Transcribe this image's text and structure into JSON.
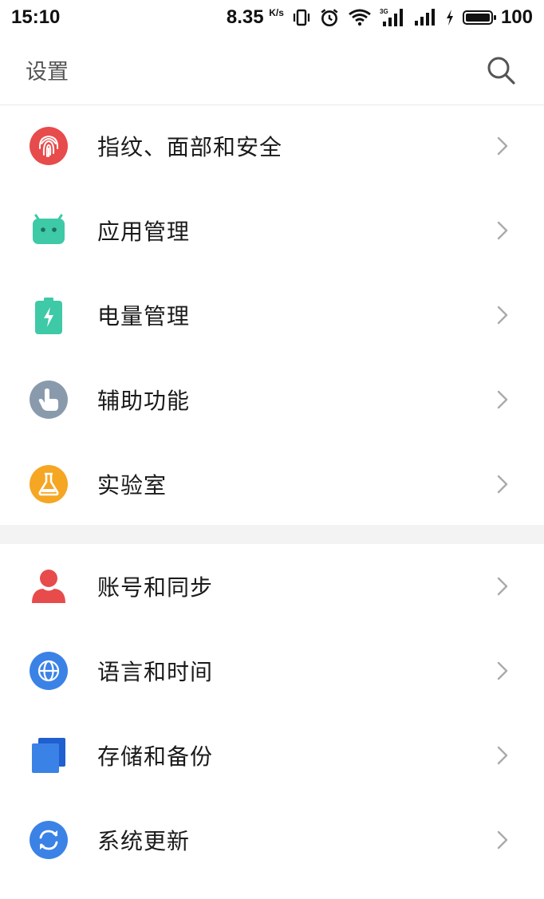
{
  "status_bar": {
    "time": "15:10",
    "net_speed": "8.35",
    "net_speed_unit": "K/s",
    "network_type": "3G",
    "battery": "100"
  },
  "header": {
    "title": "设置"
  },
  "groups": [
    {
      "items": [
        {
          "label": "指纹、面部和安全",
          "icon": "fingerprint-icon",
          "color": "#e84b4b"
        },
        {
          "label": "应用管理",
          "icon": "android-icon",
          "color": "#3ec9a7"
        },
        {
          "label": "电量管理",
          "icon": "battery-charge-icon",
          "color": "#3ec9a7"
        },
        {
          "label": "辅助功能",
          "icon": "hand-touch-icon",
          "color": "#8a9aad"
        },
        {
          "label": "实验室",
          "icon": "flask-icon",
          "color": "#f5a623"
        }
      ]
    },
    {
      "items": [
        {
          "label": "账号和同步",
          "icon": "account-icon",
          "color": "#e84b4b"
        },
        {
          "label": "语言和时间",
          "icon": "globe-icon",
          "color": "#3b82e6"
        },
        {
          "label": "存储和备份",
          "icon": "storage-icon",
          "color": "#3b82e6"
        },
        {
          "label": "系统更新",
          "icon": "update-icon",
          "color": "#3b82e6"
        }
      ]
    }
  ]
}
